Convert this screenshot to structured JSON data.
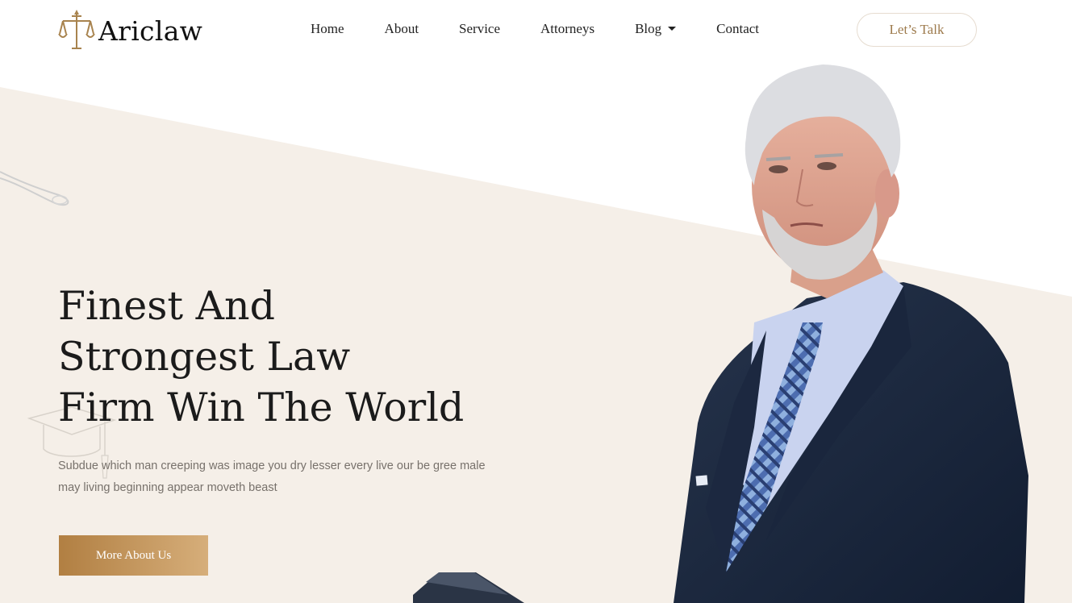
{
  "brand": {
    "name": "Ariclaw",
    "accent": "#b17f42",
    "hero_bg": "#f5efe8"
  },
  "nav": {
    "items": [
      {
        "label": "Home"
      },
      {
        "label": "About"
      },
      {
        "label": "Service"
      },
      {
        "label": "Attorneys"
      },
      {
        "label": "Blog",
        "has_dropdown": true
      },
      {
        "label": "Contact"
      }
    ],
    "cta_label": "Let’s Talk"
  },
  "hero": {
    "title_lines": [
      "Finest And",
      "Strongest Law",
      "Firm Win The World"
    ],
    "subtitle": "Subdue which man creeping was image you dry lesser every live our be gree male may living beginning appear moveth beast",
    "button_label": "More About Us"
  },
  "icons": [
    "scales-of-justice-icon",
    "chevron-down-icon",
    "gavel-sketch-icon",
    "graduation-cap-sketch-icon"
  ]
}
